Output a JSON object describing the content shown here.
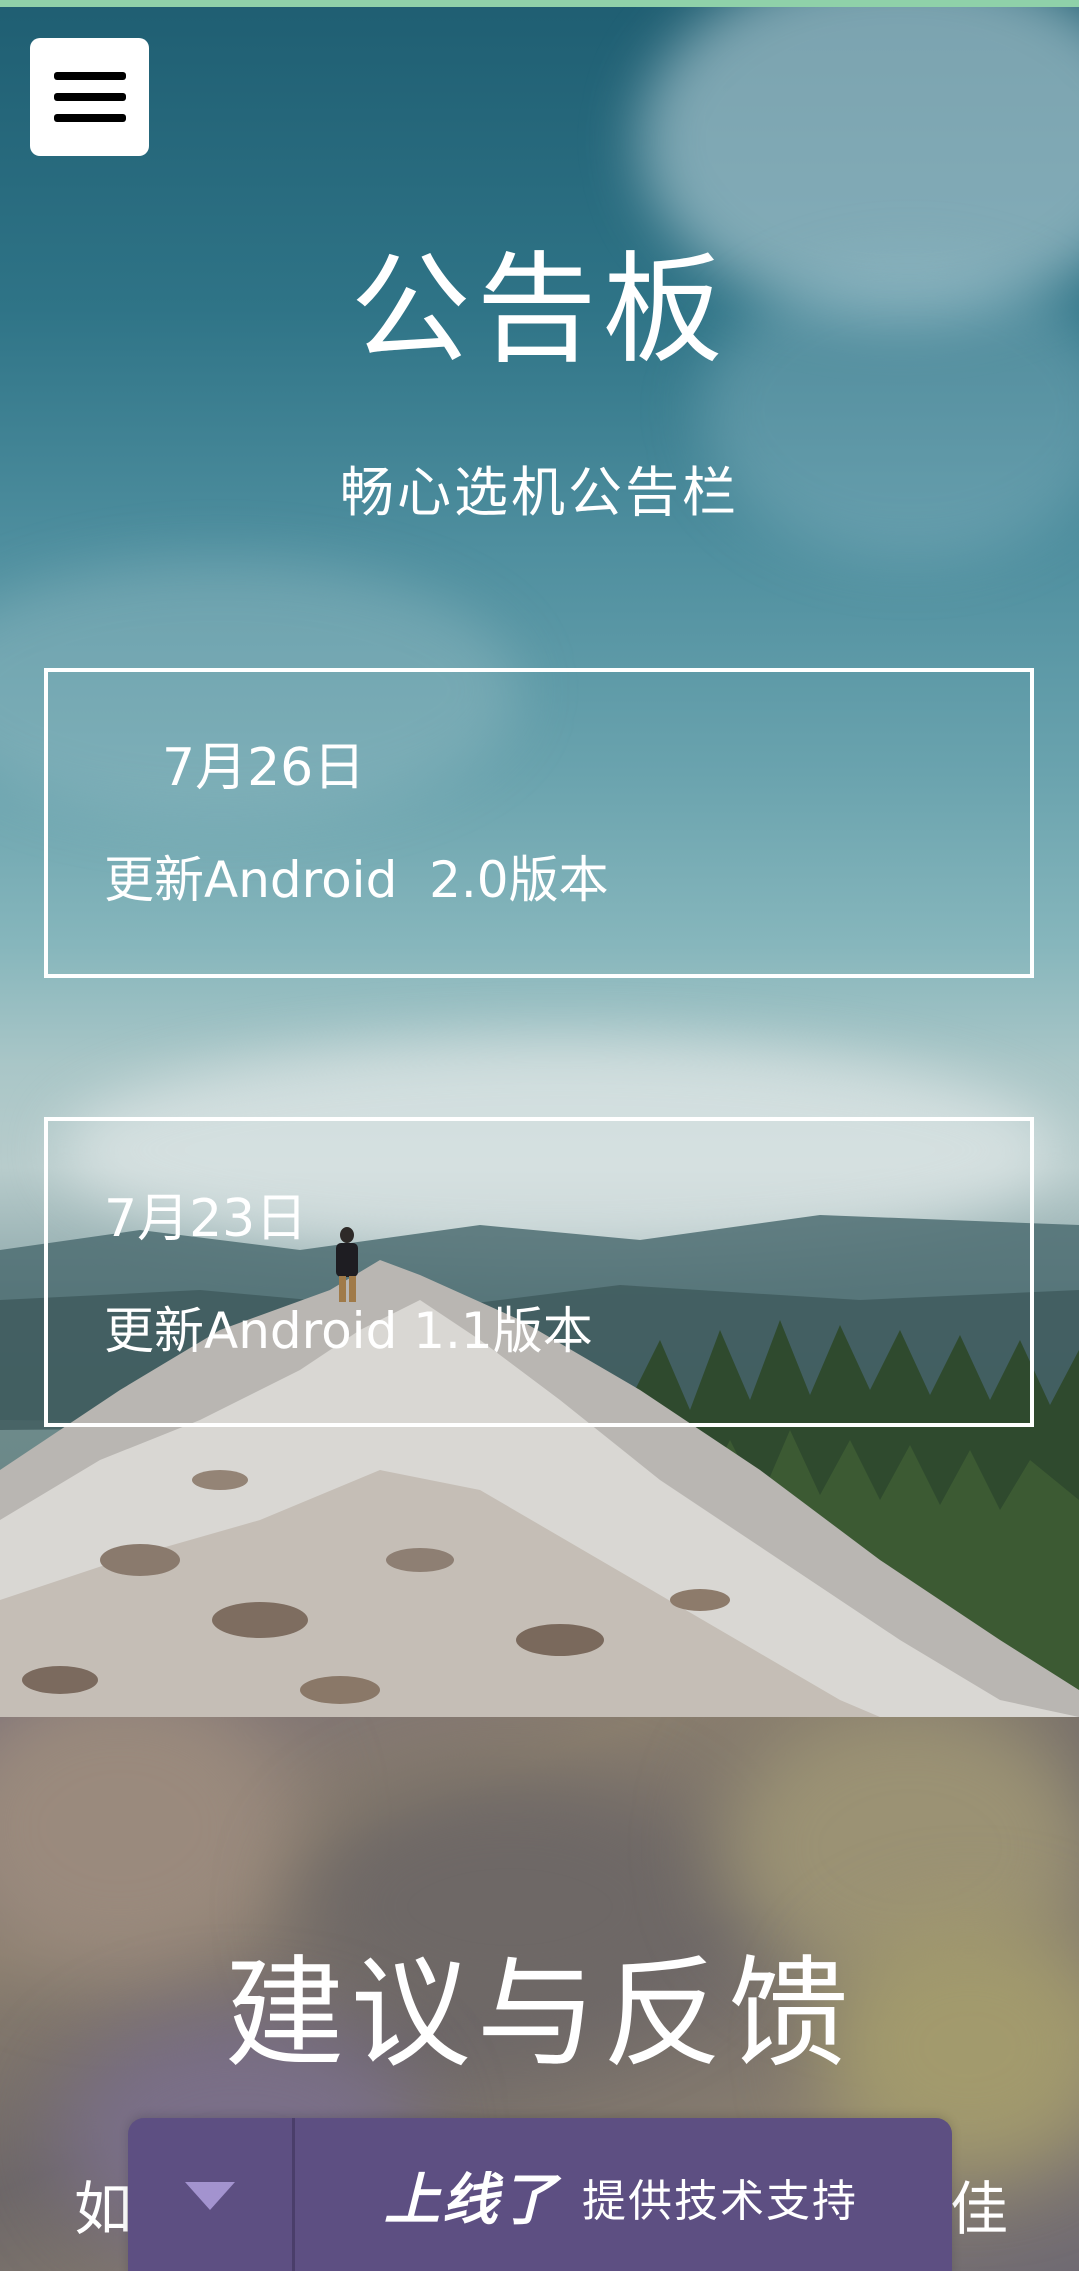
{
  "header": {
    "menu_icon": "hamburger-menu-icon"
  },
  "announcement": {
    "title": "公告板",
    "subtitle": "畅心选机公告栏",
    "items": [
      {
        "date": "7月26日",
        "text": "更新Android  2.0版本"
      },
      {
        "date": "7月23日",
        "text": "更新Android 1.1版本"
      }
    ]
  },
  "feedback": {
    "title": "建议与反馈",
    "text_left": "如",
    "text_right": "佳"
  },
  "banner": {
    "toggle_icon": "chevron-down-icon",
    "brand": "上线了",
    "tagline": "提供技术支持",
    "background": "#5d4f82"
  },
  "colors": {
    "top_strip": "#8fd1a9",
    "text": "#ffffff"
  }
}
